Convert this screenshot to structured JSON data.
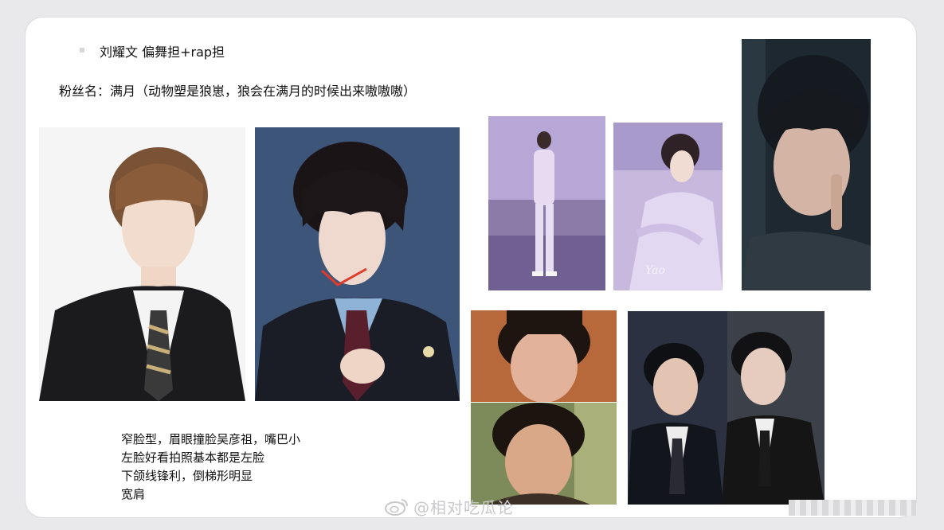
{
  "header": {
    "title": "刘耀文 偏舞担+rap担",
    "fan_name": "粉丝名：满月（动物塑是狼崽，狼会在满月的时候出来嗷嗷嗷）"
  },
  "notes": [
    "窄脸型，眉眼撞脸吴彦祖，嘴巴小",
    "左脸好看拍照基本都是左脸",
    "下颌线锋利，倒梯形明显",
    "宽肩"
  ],
  "watermark": "@相对吃瓜论",
  "photos": [
    {
      "name": "photo-suit-white-bg",
      "bg": "#f4f4f4",
      "accent": "#1c1c1c"
    },
    {
      "name": "photo-suit-blue-bg",
      "bg": "#3b5478",
      "accent": "#15161c"
    },
    {
      "name": "photo-lavender-beach-standing",
      "bg": "#b9a9d8",
      "accent": "#d8c8ec"
    },
    {
      "name": "photo-lavender-beach-sitting",
      "bg": "#a99ccc",
      "accent": "#e2d6f2"
    },
    {
      "name": "photo-dark-portrait",
      "bg": "#1f2a33",
      "accent": "#3a4650"
    },
    {
      "name": "photo-compare-top",
      "bg": "#b96a3a",
      "accent": "#2a1a12"
    },
    {
      "name": "photo-compare-bottom",
      "bg": "#7a8a55",
      "accent": "#201812"
    },
    {
      "name": "photo-compare-duo",
      "bg": "#2b3140",
      "accent": "#0e0f14"
    }
  ]
}
